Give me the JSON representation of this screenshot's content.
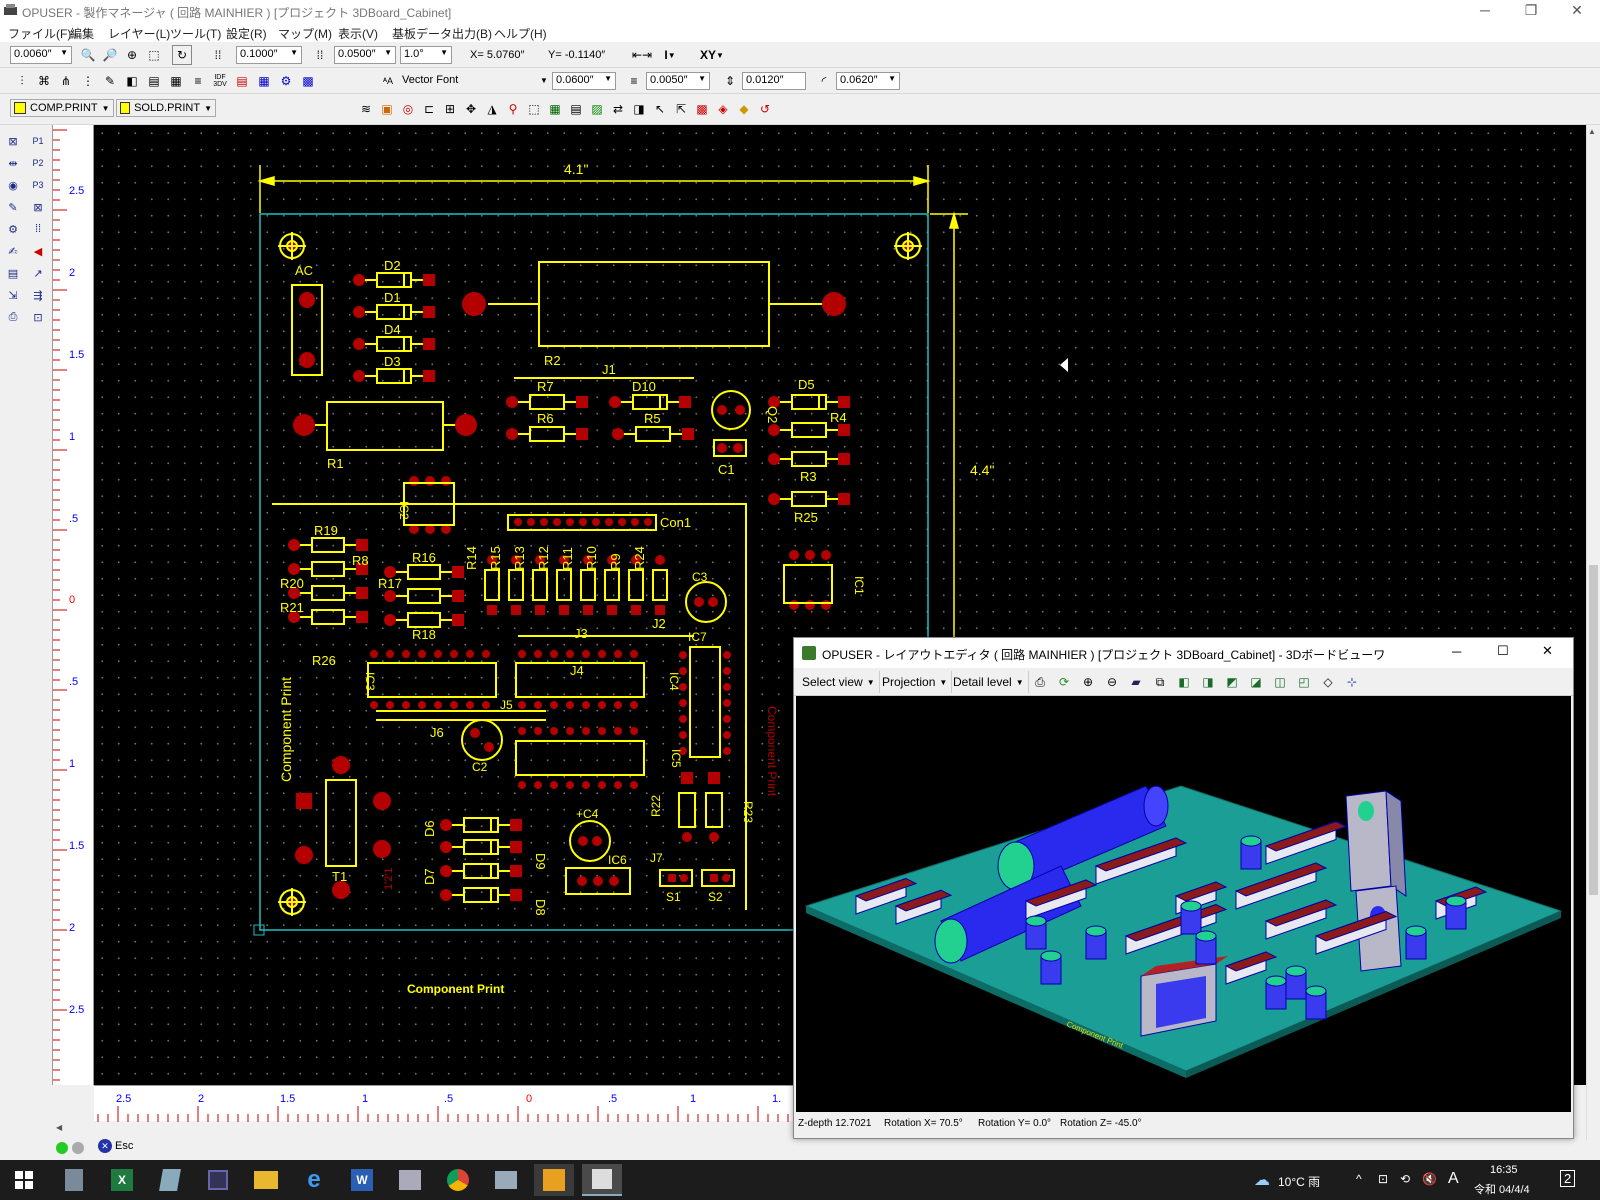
{
  "window": {
    "title": "OPUSER - 製作マネージャ ( 回路 MAINHIER ) [プロジェクト 3DBoard_Cabinet]",
    "minimize": "─",
    "maximize": "❐",
    "close": "✕"
  },
  "menu": [
    "ファイル(F)",
    "編集",
    "レイヤー(L)",
    "ツール(T)",
    "設定(R)",
    "マップ(M)",
    "表示(V)",
    "基板データ出力(B)",
    "ヘルプ(H)"
  ],
  "toolbar1": {
    "grid_value": "0.0060″",
    "snap_value": "0.1000″",
    "grid2_value": "0.0500″",
    "angle_value": "1.0°",
    "coord_x": "X= 5.0760″",
    "coord_y": "Y= -0.1140″",
    "mode_i": "I",
    "mode_xy": "XY"
  },
  "toolbar2": {
    "font_name": "Vector Font",
    "font_size": "0.0600″",
    "line_width": "0.0050″",
    "spacing": "0.0120″",
    "arc_value": "0.0620″",
    "idf_label": "IDF 3DV"
  },
  "toolbar3": {
    "layer1": "COMP.PRINT",
    "layer2": "SOLD.PRINT",
    "layer1_color": "#ffff00",
    "layer2_color": "#ffff00"
  },
  "left_tools": [
    "P1",
    "P2",
    "P3"
  ],
  "vruler": {
    "labels": [
      "2.5",
      "2",
      "1.5",
      "1",
      ".5",
      "0",
      ".5",
      "1",
      "1.5",
      "2",
      "2.5"
    ]
  },
  "hruler": {
    "labels": [
      "2.5",
      "2",
      "1.5",
      "1",
      ".5",
      "0",
      ".5",
      "1",
      "1."
    ]
  },
  "pcb": {
    "width_dim": "4.1\"",
    "height_dim": "4.4\"",
    "silk_text": "Component Print",
    "bottom_text": "Component Print",
    "rev_text": "1'2'1",
    "refs": {
      "AC": "AC",
      "D2": "D2",
      "D1": "D1",
      "D4": "D4",
      "D3": "D3",
      "R2": "R2",
      "R1": "R1",
      "J1": "J1",
      "R7": "R7",
      "D10": "D10",
      "Q2": "Q2",
      "D5": "D5",
      "R6": "R6",
      "R5": "R5",
      "R4": "R4",
      "C1": "C1",
      "R3": "R3",
      "R25": "R25",
      "IC2": "IC2",
      "Con1": "Con1",
      "R19": "R19",
      "R8": "R8",
      "R16": "R16",
      "R20": "R20",
      "R17": "R17",
      "R21": "R21",
      "R18": "R18",
      "R26": "R26",
      "R14": "R14",
      "R15": "R15",
      "R13": "R13",
      "R12": "R12",
      "R11": "R11",
      "R10": "R10",
      "R9": "R9",
      "R24": "R24",
      "C3": "C3",
      "IC1": "IC1",
      "J2": "J2",
      "J3": "J3",
      "IC7": "IC7",
      "IC3": "IC3",
      "J4": "J4",
      "IC4": "IC4",
      "J5": "J5",
      "J6": "J6",
      "C2": "C2",
      "IC5": "IC5",
      "T1": "T1",
      "D6": "D6",
      "D9": "D9",
      "D7": "D7",
      "D8": "D8",
      "C4": "+C4",
      "IC6": "IC6",
      "R22": "R22",
      "R23": "R23",
      "J7": "J7",
      "S1": "S1",
      "S2": "S2"
    }
  },
  "viewer3d": {
    "title": "OPUSER - レイアウトエディタ ( 回路 MAINHIER ) [プロジェクト 3DBoard_Cabinet] - 3Dボードビューワ",
    "select_view": "Select view",
    "projection": "Projection",
    "detail_level": "Detail level",
    "status": {
      "zdepth": "Z-depth 12.7021",
      "rotx": "Rotation X= 70.5°",
      "roty": "Rotation Y= 0.0°",
      "rotz": "Rotation Z= -45.0°"
    },
    "minimize": "─",
    "maximize": "☐",
    "close": "✕"
  },
  "statusbar": {
    "esc": "Esc"
  },
  "taskbar": {
    "weather": "10°C 雨",
    "time": "16:35",
    "date": "令和 04/4/4",
    "ime": "A",
    "notif": "2"
  },
  "colors": {
    "silk": "#ffff00",
    "pad": "#b40000",
    "outline": "#20c0c0",
    "board3d": "#1a9e95",
    "comp3d": "#3333ff"
  }
}
